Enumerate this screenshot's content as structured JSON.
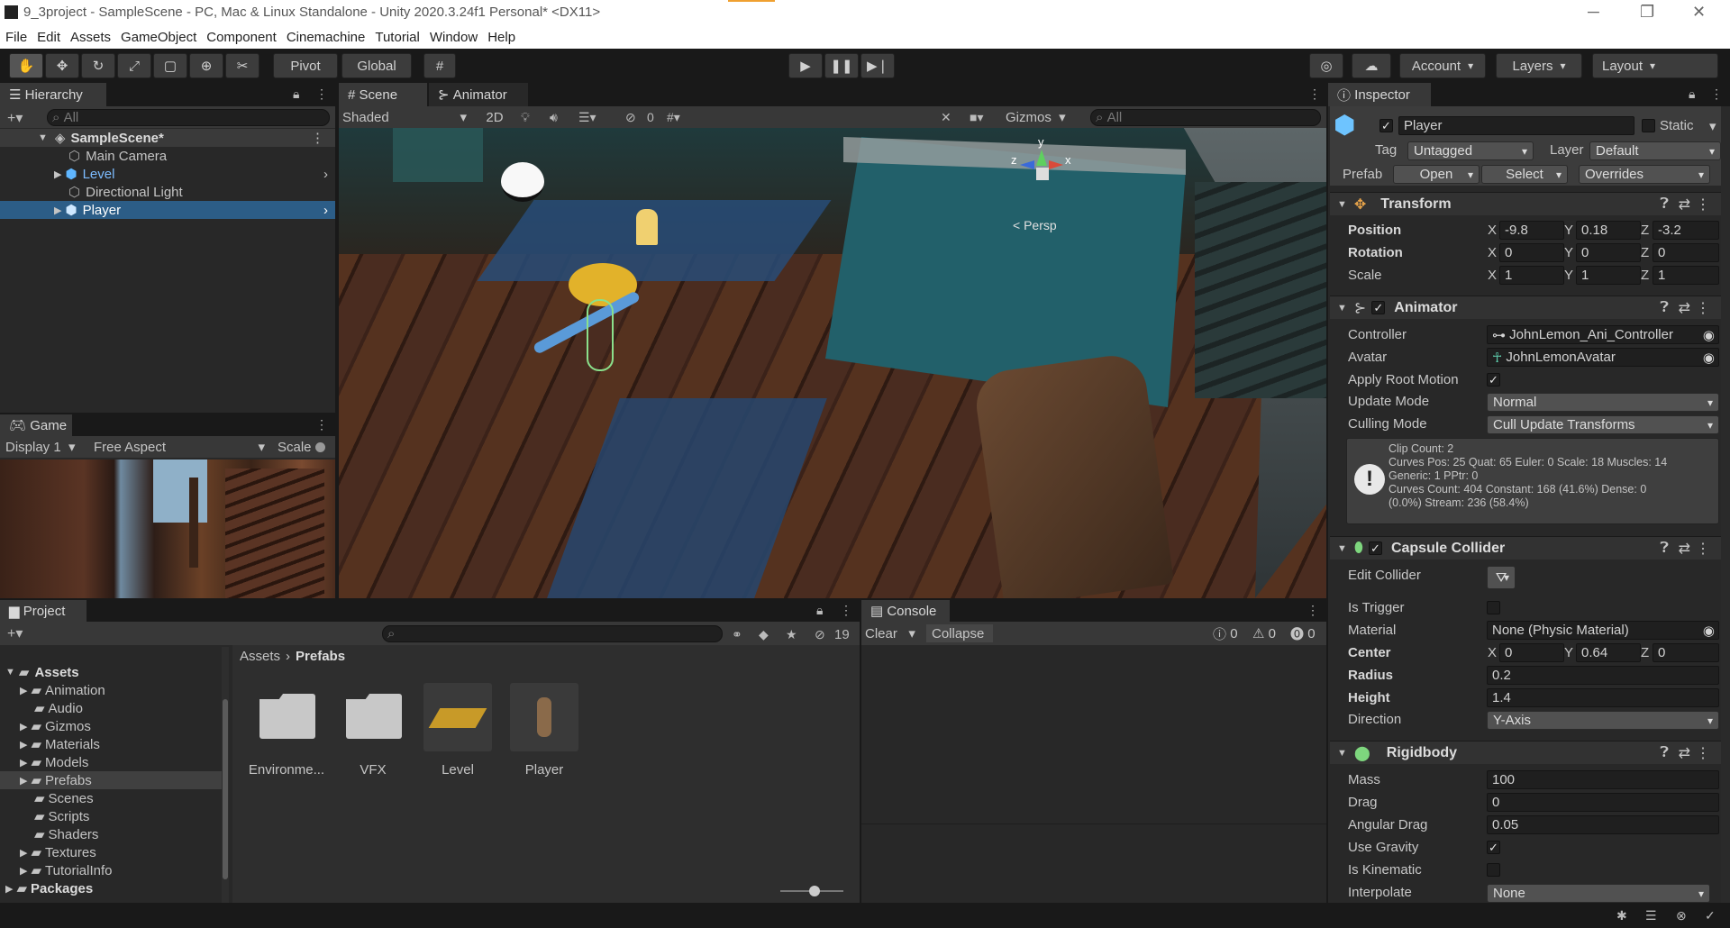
{
  "title": "9_3project - SampleScene - PC, Mac & Linux Standalone - Unity 2020.3.24f1 Personal* <DX11>",
  "menu": [
    "File",
    "Edit",
    "Assets",
    "GameObject",
    "Component",
    "Cinemachine",
    "Tutorial",
    "Window",
    "Help"
  ],
  "toolbar": {
    "pivot": "Pivot",
    "global": "Global",
    "account": "Account",
    "layers": "Layers",
    "layout": "Layout"
  },
  "hierarchy": {
    "tab": "Hierarchy",
    "search_placeholder": "All",
    "scene": "SampleScene*",
    "items": [
      "Main Camera",
      "Level",
      "Directional Light",
      "Player"
    ]
  },
  "scene_view": {
    "tab_scene": "Scene",
    "tab_animator": "Animator",
    "shading": "Shaded",
    "mode_2d": "2D",
    "hidden_count": "0",
    "gizmos": "Gizmos",
    "search_placeholder": "All",
    "persp": "< Persp",
    "axis_x": "x",
    "axis_y": "y",
    "axis_z": "z"
  },
  "game_view": {
    "tab": "Game",
    "display": "Display 1",
    "aspect": "Free Aspect",
    "scale": "Scale"
  },
  "project": {
    "tab": "Project",
    "hidden_count": "19",
    "breadcrumb": [
      "Assets",
      "Prefabs"
    ],
    "tree_root": "Assets",
    "tree": [
      "Animation",
      "Audio",
      "Gizmos",
      "Materials",
      "Models",
      "Prefabs",
      "Scenes",
      "Scripts",
      "Shaders",
      "Textures",
      "TutorialInfo"
    ],
    "packages": "Packages",
    "assets": [
      "Environme...",
      "VFX",
      "Level",
      "Player"
    ]
  },
  "console": {
    "tab": "Console",
    "clear": "Clear",
    "collapse": "Collapse",
    "logs": "0",
    "warnings": "0",
    "errors": "0"
  },
  "inspector": {
    "tab": "Inspector",
    "name": "Player",
    "static": "Static",
    "tag_label": "Tag",
    "tag": "Untagged",
    "layer_label": "Layer",
    "layer": "Default",
    "prefab_label": "Prefab",
    "open": "Open",
    "select": "Select",
    "overrides": "Overrides",
    "transform": {
      "title": "Transform",
      "position": {
        "label": "Position",
        "x": "-9.8",
        "y": "0.18",
        "z": "-3.2"
      },
      "rotation": {
        "label": "Rotation",
        "x": "0",
        "y": "0",
        "z": "0"
      },
      "scale": {
        "label": "Scale",
        "x": "1",
        "y": "1",
        "z": "1"
      }
    },
    "animator": {
      "title": "Animator",
      "controller_label": "Controller",
      "controller": "JohnLemon_Ani_Controller",
      "avatar_label": "Avatar",
      "avatar": "JohnLemonAvatar",
      "root_motion_label": "Apply Root Motion",
      "update_label": "Update Mode",
      "update": "Normal",
      "culling_label": "Culling Mode",
      "culling": "Cull Update Transforms",
      "info": [
        "Clip Count: 2",
        "Curves Pos: 25 Quat: 65 Euler: 0 Scale: 18 Muscles: 14",
        "Generic: 1 PPtr: 0",
        "Curves Count: 404 Constant: 168 (41.6%) Dense: 0",
        "(0.0%) Stream: 236 (58.4%)"
      ]
    },
    "capsule": {
      "title": "Capsule Collider",
      "edit_label": "Edit Collider",
      "trigger_label": "Is Trigger",
      "material_label": "Material",
      "material": "None (Physic Material)",
      "center_label": "Center",
      "cx": "0",
      "cy": "0.64",
      "cz": "0",
      "radius_label": "Radius",
      "radius": "0.2",
      "height_label": "Height",
      "height": "1.4",
      "direction_label": "Direction",
      "direction": "Y-Axis"
    },
    "rigidbody": {
      "title": "Rigidbody",
      "mass_label": "Mass",
      "mass": "100",
      "drag_label": "Drag",
      "drag": "0",
      "angular_label": "Angular Drag",
      "angular": "0.05",
      "gravity_label": "Use Gravity",
      "kinematic_label": "Is Kinematic",
      "interpolate_label": "Interpolate",
      "interpolate": "None"
    }
  },
  "colors": {
    "accent": "#2c5d87",
    "selection": "#2c5d87",
    "panel": "#282828",
    "header": "#383838"
  }
}
